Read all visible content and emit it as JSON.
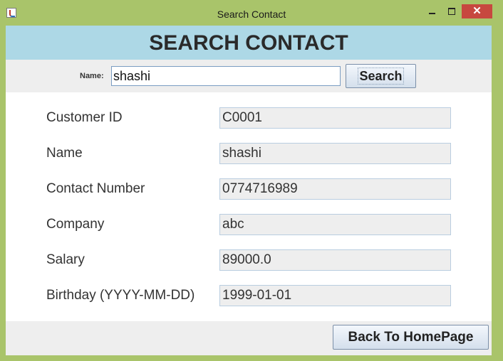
{
  "window": {
    "title": "Search Contact",
    "close_glyph": "✕"
  },
  "header": {
    "title": "SEARCH CONTACT"
  },
  "search": {
    "label": "Name:",
    "value": "shashi",
    "button_label": "Search"
  },
  "form": {
    "fields": [
      {
        "label": "Customer ID",
        "value": "C0001"
      },
      {
        "label": "Name",
        "value": "shashi"
      },
      {
        "label": "Contact Number",
        "value": "0774716989"
      },
      {
        "label": "Company",
        "value": "abc"
      },
      {
        "label": "Salary",
        "value": "89000.0"
      },
      {
        "label": "Birthday (YYYY-MM-DD)",
        "value": "1999-01-01"
      }
    ]
  },
  "footer": {
    "back_label": "Back To HomePage"
  },
  "colors": {
    "window_frame": "#a9c46a",
    "header_bg": "#add8e6",
    "close_button": "#c7483f",
    "panel_bg": "#eeeeee"
  }
}
